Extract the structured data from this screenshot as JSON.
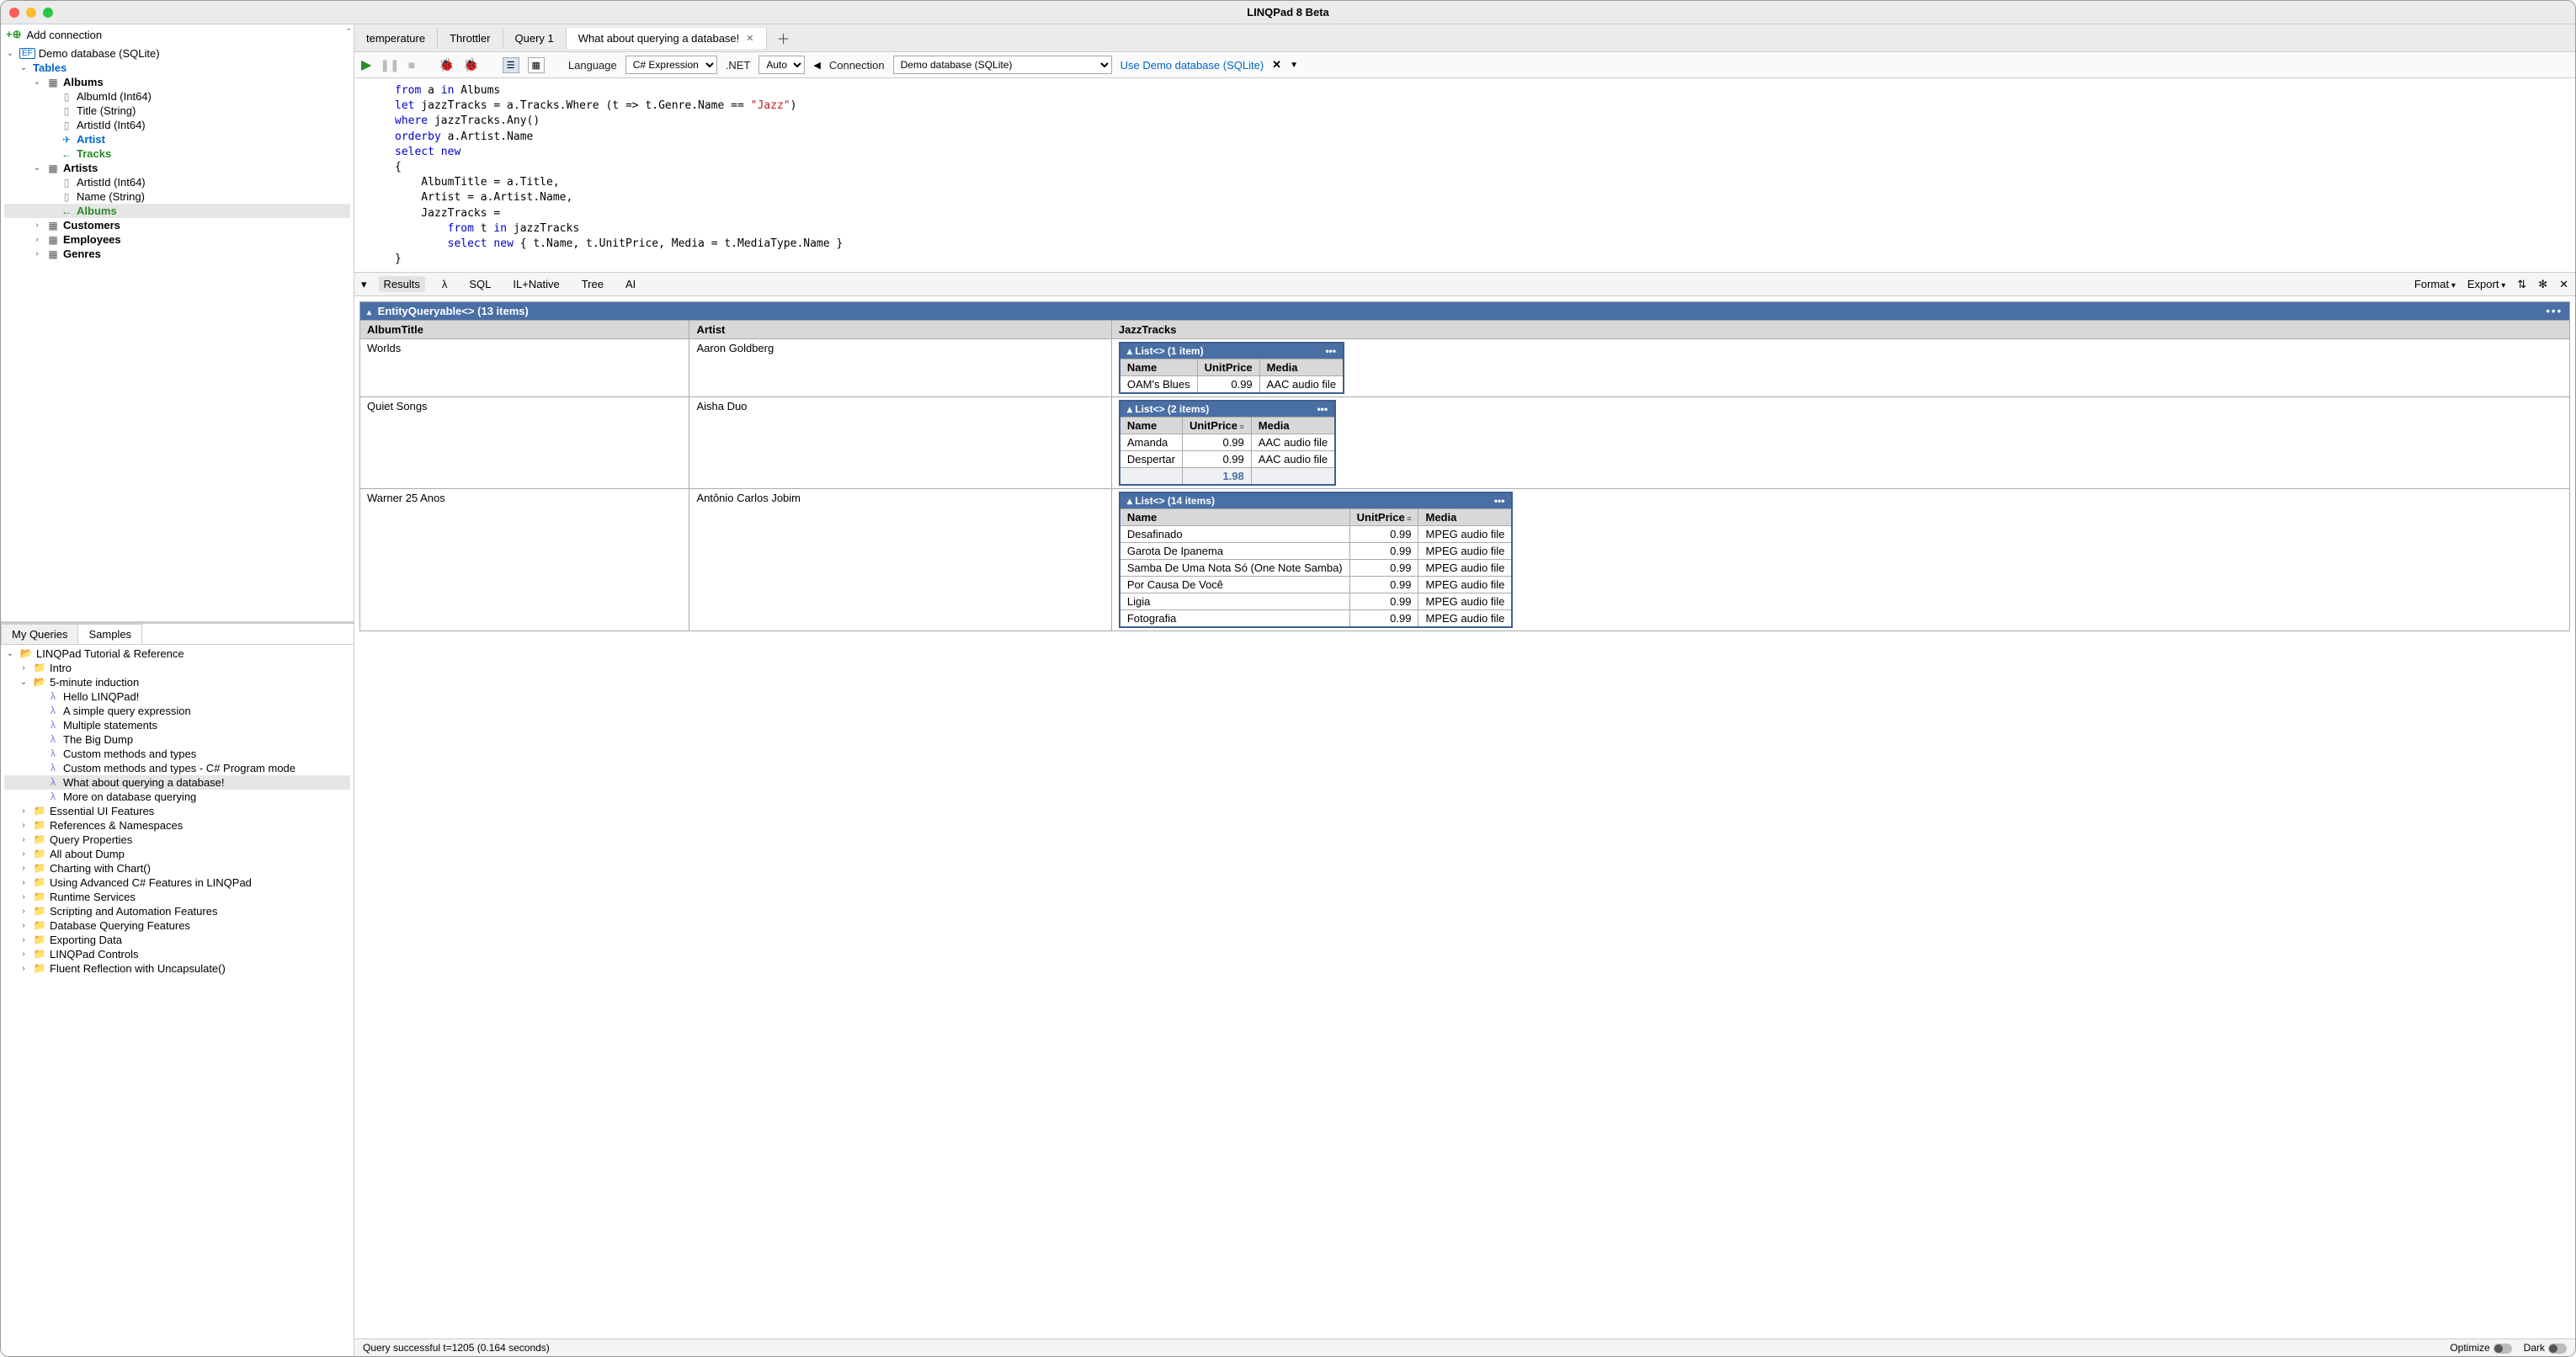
{
  "window": {
    "title": "LINQPad 8 Beta"
  },
  "left": {
    "add_connection": "Add connection",
    "schema": {
      "root": "Demo database (SQLite)",
      "badge": "EF",
      "tables_label": "Tables",
      "albums_table": "Albums",
      "albums_cols": [
        "AlbumId (Int64)",
        "Title (String)",
        "ArtistId (Int64)"
      ],
      "albums_nav_artist": "Artist",
      "albums_nav_tracks": "Tracks",
      "artists_table": "Artists",
      "artists_cols": [
        "ArtistId (Int64)",
        "Name (String)"
      ],
      "artists_nav_albums": "Albums",
      "other_tables": [
        "Customers",
        "Employees",
        "Genres"
      ]
    },
    "tabs": {
      "my_queries": "My Queries",
      "samples": "Samples"
    },
    "samples": {
      "root": "LINQPad Tutorial & Reference",
      "intro": "Intro",
      "five_min": "5-minute induction",
      "five_min_items": [
        "Hello LINQPad!",
        "A simple query expression",
        "Multiple statements",
        "The Big Dump",
        "Custom methods and types",
        "Custom methods and types - C# Program mode",
        "What about querying a database!",
        "More on database querying"
      ],
      "other_folders": [
        "Essential UI Features",
        "References & Namespaces",
        "Query Properties",
        "All about Dump",
        "Charting with Chart()",
        "Using Advanced C# Features in LINQPad",
        "Runtime Services",
        "Scripting and Automation Features",
        "Database Querying Features",
        "Exporting Data",
        "LINQPad Controls",
        "Fluent Reflection with Uncapsulate()"
      ]
    }
  },
  "right": {
    "tabs": [
      "temperature",
      "Throttler",
      "Query 1",
      "What about querying a database!"
    ],
    "toolbar": {
      "language_label": "Language",
      "language_value": "C# Expression",
      "dotnet_label": ".NET",
      "dotnet_value": "Auto",
      "connection_label": "Connection",
      "connection_value": "Demo database (SQLite)",
      "use_demo": "Use Demo database (SQLite)"
    },
    "editor": {
      "l1a": "from",
      "l1b": " a ",
      "l1c": "in",
      "l1d": " Albums",
      "l2a": "let",
      "l2b": " jazzTracks = a.Tracks.Where (t => t.Genre.Name == ",
      "l2c": "\"Jazz\"",
      "l2d": ")",
      "l3a": "where",
      "l3b": " jazzTracks.Any()",
      "l4a": "orderby",
      "l4b": " a.Artist.Name",
      "l5a": "select",
      "l5b": " ",
      "l5c": "new",
      "l6": "{",
      "l7": "    AlbumTitle = a.Title,",
      "l8": "    Artist = a.Artist.Name,",
      "l9": "    JazzTracks =",
      "l10a": "        ",
      "l10b": "from",
      "l10c": " t ",
      "l10d": "in",
      "l10e": " jazzTracks",
      "l11a": "        ",
      "l11b": "select",
      "l11c": " ",
      "l11d": "new",
      "l11e": " { t.Name, t.UnitPrice, Media = t.MediaType.Name }",
      "l12": "}"
    },
    "results_tabs": {
      "results": "Results",
      "lambda": "λ",
      "sql": "SQL",
      "ilnative": "IL+Native",
      "tree": "Tree",
      "ai": "AI",
      "format": "Format",
      "export": "Export"
    },
    "results": {
      "header": "EntityQueryable<> (13 items)",
      "columns": [
        "AlbumTitle",
        "Artist",
        "JazzTracks"
      ],
      "nested_cols": [
        "Name",
        "UnitPrice",
        "Media"
      ],
      "rows": [
        {
          "album": "Worlds",
          "artist": "Aaron Goldberg",
          "nested_header": "List<> (1 item)",
          "tracks": [
            {
              "name": "OAM's Blues",
              "price": "0.99",
              "media": "AAC audio file"
            }
          ]
        },
        {
          "album": "Quiet Songs",
          "artist": "Aisha Duo",
          "nested_header": "List<> (2 items)",
          "tracks": [
            {
              "name": "Amanda",
              "price": "0.99",
              "media": "AAC audio file"
            },
            {
              "name": "Despertar",
              "price": "0.99",
              "media": "AAC audio file"
            }
          ],
          "sum": "1.98"
        },
        {
          "album": "Warner 25 Anos",
          "artist": "Antônio Carlos Jobim",
          "nested_header": "List<> (14 items)",
          "tracks": [
            {
              "name": "Desafinado",
              "price": "0.99",
              "media": "MPEG audio file"
            },
            {
              "name": "Garota De Ipanema",
              "price": "0.99",
              "media": "MPEG audio file"
            },
            {
              "name": "Samba De Uma Nota Só (One Note Samba)",
              "price": "0.99",
              "media": "MPEG audio file"
            },
            {
              "name": "Por Causa De Você",
              "price": "0.99",
              "media": "MPEG audio file"
            },
            {
              "name": "Ligia",
              "price": "0.99",
              "media": "MPEG audio file"
            },
            {
              "name": "Fotografia",
              "price": "0.99",
              "media": "MPEG audio file"
            }
          ]
        }
      ]
    },
    "status": {
      "left": "Query successful t=1205   (0.164 seconds)",
      "optimize": "Optimize",
      "dark": "Dark"
    }
  }
}
